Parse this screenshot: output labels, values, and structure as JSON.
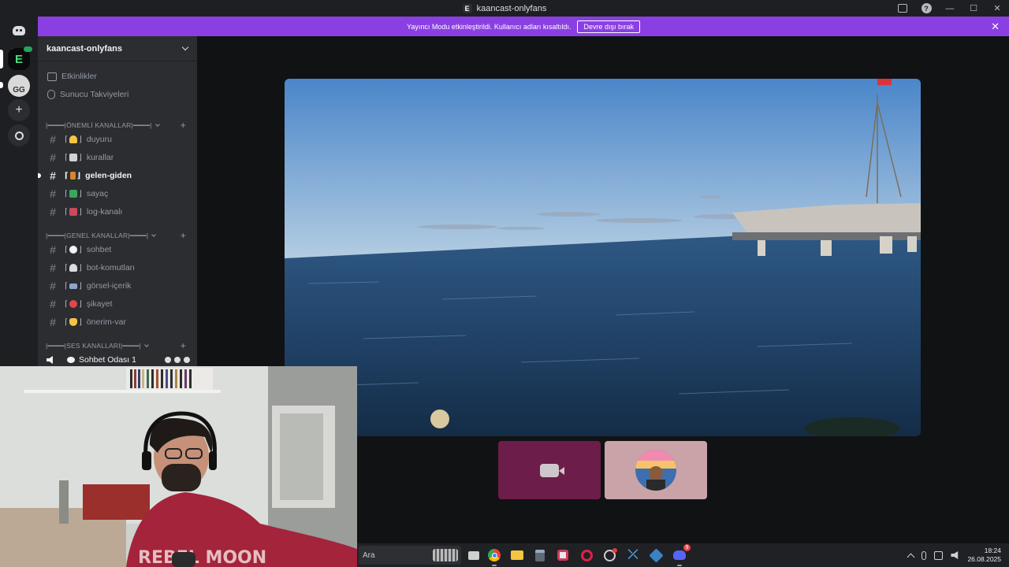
{
  "window": {
    "title": "kaancast-onlyfans",
    "server_letter": "E"
  },
  "banner": {
    "message": "Yayıncı Modu etkinleştirildi. Kullanıcı adları kısaltıldı.",
    "button": "Devre dışı bırak"
  },
  "rail": {
    "gg_label": "GG"
  },
  "server": {
    "name": "kaancast-onlyfans"
  },
  "nav": [
    {
      "label": "Etkinlikler"
    },
    {
      "label": "Sunucu Takviyeleri"
    }
  ],
  "categories": [
    {
      "label": "|━━━━|ÖNEMLİ KANALLAR|━━━━|"
    },
    {
      "label": "|━━━━|GENEL KANALLAR|━━━━|"
    },
    {
      "label": "|━━━━|SES KANALLARI|━━━━|"
    }
  ],
  "channels": [
    {
      "name": "duyuru",
      "emoji_color": "#f5c542"
    },
    {
      "name": "kurallar",
      "emoji_color": "#cfd3d8"
    },
    {
      "name": "gelen-giden",
      "emoji_color": "#d9862b"
    },
    {
      "name": "sayaç",
      "emoji_color": "#3ba55d"
    },
    {
      "name": "log-kanalı",
      "emoji_color": "#c94a5a"
    },
    {
      "name": "sohbet",
      "emoji_color": "#f2f3f5"
    },
    {
      "name": "bot-komutları",
      "emoji_color": "#dcdcdc"
    },
    {
      "name": "görsel-içerik",
      "emoji_color": "#8fa6c9"
    },
    {
      "name": "şikayet",
      "emoji_color": "#e0474c"
    },
    {
      "name": "önerim-var",
      "emoji_color": "#f5c542"
    }
  ],
  "voice": {
    "channel_name": "Sohbet Odası 1"
  },
  "taskbar": {
    "search_placeholder": "Ara",
    "time": "18:24",
    "date": "26.08.2025",
    "discord_badge": "9"
  }
}
